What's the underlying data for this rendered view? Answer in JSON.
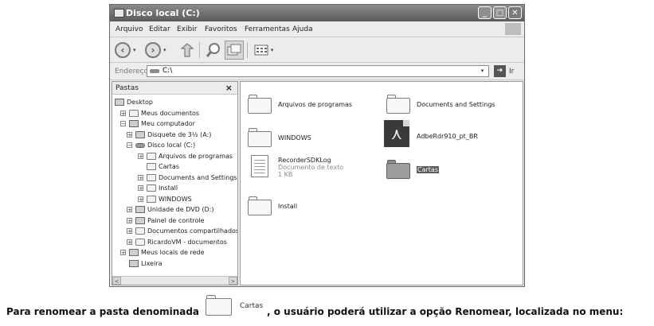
{
  "window": {
    "title": "Disco local (C:)",
    "min_label": "_",
    "max_label": "□",
    "close_label": "✕"
  },
  "menu": {
    "items": [
      "Arquivo",
      "Editar",
      "Exibir",
      "Favoritos",
      "Ferramentas",
      "Ajuda"
    ]
  },
  "toolbar": {
    "back_icon": "back-arrow-icon",
    "forward_icon": "forward-arrow-icon",
    "up_icon": "up-folder-icon",
    "search_icon": "search-icon",
    "folders_icon": "folders-icon",
    "views_icon": "views-icon"
  },
  "address": {
    "label": "Endereço",
    "value": "C:\\",
    "go_label": "Ir"
  },
  "left_pane": {
    "title": "Pastas",
    "close": "×",
    "tree": [
      {
        "label": "Desktop",
        "level": 0,
        "expander": "",
        "icon": "desktop-icon"
      },
      {
        "label": "Meus documentos",
        "level": 1,
        "expander": "+",
        "icon": "folder-icon"
      },
      {
        "label": "Meu computador",
        "level": 1,
        "expander": "−",
        "icon": "computer-icon"
      },
      {
        "label": "Disquete de 3½ (A:)",
        "level": 2,
        "expander": "+",
        "icon": "floppy-icon"
      },
      {
        "label": "Disco local (C:)",
        "level": 2,
        "expander": "−",
        "icon": "drive-icon"
      },
      {
        "label": "Arquivos de programas",
        "level": 3,
        "expander": "+",
        "icon": "folder-icon"
      },
      {
        "label": "Cartas",
        "level": 3,
        "expander": "",
        "icon": "folder-icon"
      },
      {
        "label": "Documents and Settings",
        "level": 3,
        "expander": "+",
        "icon": "folder-icon"
      },
      {
        "label": "Install",
        "level": 3,
        "expander": "+",
        "icon": "folder-icon"
      },
      {
        "label": "WINDOWS",
        "level": 3,
        "expander": "+",
        "icon": "folder-icon"
      },
      {
        "label": "Unidade de DVD (D:)",
        "level": 2,
        "expander": "+",
        "icon": "dvd-icon"
      },
      {
        "label": "Painel de controle",
        "level": 2,
        "expander": "+",
        "icon": "control-panel-icon"
      },
      {
        "label": "Documentos compartilhados",
        "level": 2,
        "expander": "+",
        "icon": "folder-icon"
      },
      {
        "label": "RicardoVM - documentos",
        "level": 2,
        "expander": "+",
        "icon": "folder-icon"
      },
      {
        "label": "Meus locais de rede",
        "level": 1,
        "expander": "+",
        "icon": "network-icon"
      },
      {
        "label": "Lixeira",
        "level": 1,
        "expander": "",
        "icon": "recycle-bin-icon"
      }
    ],
    "scroll_left": "<",
    "scroll_right": ">"
  },
  "right_pane": {
    "items": [
      {
        "name": "Arquivos de programas",
        "type": "folder"
      },
      {
        "name": "Documents and Settings",
        "type": "folder"
      },
      {
        "name": "WINDOWS",
        "type": "folder"
      },
      {
        "name": "AdbeRdr910_pt_BR",
        "type": "pdf"
      },
      {
        "name": "RecorderSDKLog",
        "type": "document",
        "sub1": "Documento de texto",
        "sub2": "1 KB"
      },
      {
        "name": "Cartas",
        "type": "folder",
        "selected": true
      },
      {
        "name": "Install",
        "type": "folder"
      }
    ]
  },
  "caption": {
    "before": "Para renomear a pasta denominada",
    "folder_name": "Cartas",
    "after": ", o usuário poderá utilizar a opção Renomear, localizada no menu:"
  }
}
